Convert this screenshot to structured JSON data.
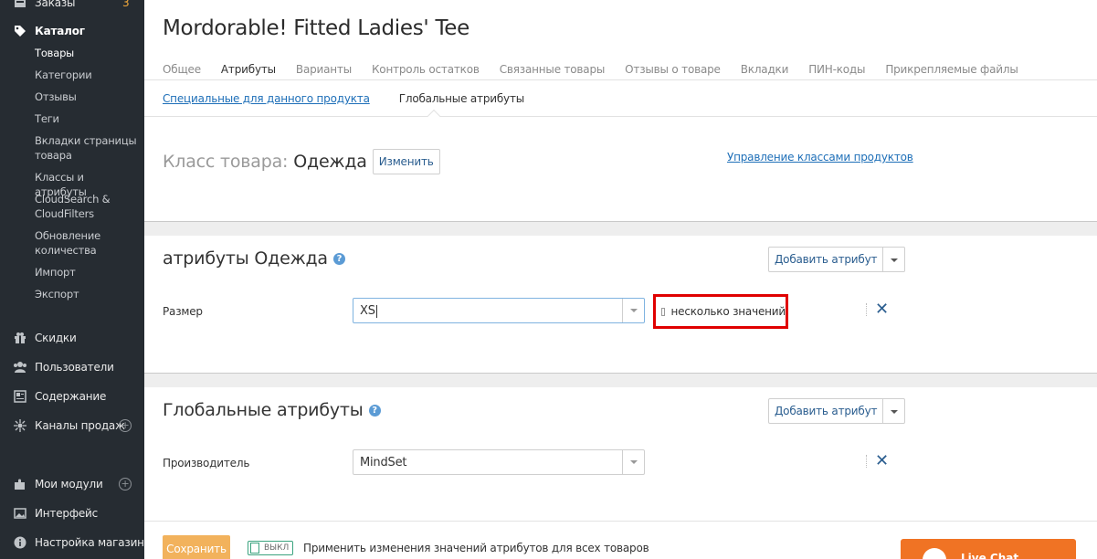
{
  "sidebar": {
    "orders": {
      "label": "Заказы",
      "badge": "3",
      "icon": "orders-icon"
    },
    "catalog": {
      "label": "Каталог",
      "icon": "tag-icon"
    },
    "catalog_items": [
      "Товары",
      "Категории",
      "Отзывы",
      "Теги",
      "Вкладки страницы товара",
      "Классы и атрибуты",
      "CloudSearch & CloudFilters",
      "Обновление количества",
      "Импорт",
      "Экспорт"
    ],
    "discounts": {
      "label": "Скидки",
      "icon": "gift-icon"
    },
    "users": {
      "label": "Пользователи",
      "icon": "users-icon"
    },
    "content": {
      "label": "Содержание",
      "icon": "content-icon"
    },
    "channels": {
      "label": "Каналы продаж",
      "icon": "channels-icon"
    },
    "modules": {
      "label": "Мои модули",
      "icon": "puzzle-icon"
    },
    "interface": {
      "label": "Интерфейс",
      "icon": "image-icon"
    },
    "store_settings": {
      "label": "Настройка магазина",
      "icon": "info-icon"
    }
  },
  "page": {
    "title": "Mordorable! Fitted Ladies' Tee",
    "tabs": [
      "Общее",
      "Атрибуты",
      "Варианты",
      "Контроль остатков",
      "Связанные товары",
      "Отзывы о товаре",
      "Вкладки",
      "ПИН-коды",
      "Прикрепляемые файлы"
    ],
    "active_tab": "Атрибуты",
    "subtabs": {
      "specific": "Специальные для данного продукта",
      "global": "Глобальные атрибуты"
    }
  },
  "product_class": {
    "label": "Класс товара:",
    "value": "Одежда",
    "change_button": "Изменить",
    "manage_link": "Управление классами продуктов"
  },
  "class_attributes": {
    "title": "атрибуты Одежда",
    "add_button": "Добавить атрибут",
    "field_label": "Размер",
    "field_value": "XS",
    "multiple_label": "несколько значений",
    "multiple_checked": false
  },
  "global_attributes": {
    "title": "Глобальные атрибуты",
    "add_button": "Добавить атрибут",
    "field_label": "Производитель",
    "field_value": "MindSet"
  },
  "footer": {
    "save_button": "Сохранить",
    "toggle_label": "ВЫКЛ",
    "apply_label": "Применить изменения значений атрибутов для всех товаров",
    "livechat_label": "Live Chat"
  },
  "colors": {
    "sidebar_bg": "#262c32",
    "accent_orange": "#f2b25c",
    "livechat_orange": "#f07324",
    "highlight_red": "#e00000",
    "link_blue": "#1e6fb8"
  }
}
